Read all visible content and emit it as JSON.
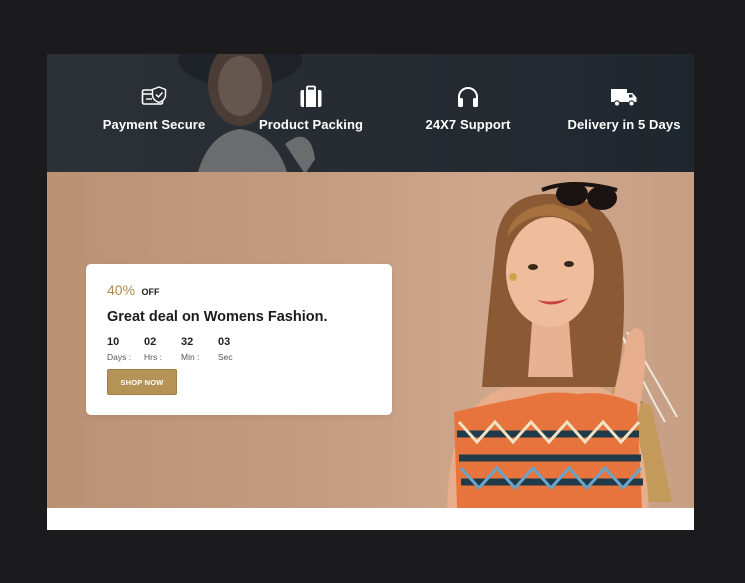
{
  "features": [
    {
      "label": "Payment Secure",
      "icon": "payment-secure-icon"
    },
    {
      "label": "Product Packing",
      "icon": "briefcase-icon"
    },
    {
      "label": "24X7 Support",
      "icon": "headphones-icon"
    },
    {
      "label": "Delivery in 5 Days",
      "icon": "delivery-truck-icon"
    }
  ],
  "promo": {
    "discount_value": "40%",
    "discount_suffix": "OFF",
    "headline": "Great deal on Womens Fashion.",
    "countdown": [
      {
        "value": "10",
        "unit": "Days :"
      },
      {
        "value": "02",
        "unit": "Hrs :"
      },
      {
        "value": "32",
        "unit": "Min :"
      },
      {
        "value": "03",
        "unit": "Sec"
      }
    ],
    "button_label": "SHOP NOW"
  },
  "colors": {
    "accent": "#b59255",
    "band": "#252b31",
    "hero_bg": "#c39c80",
    "frame": "#1b1b1d"
  }
}
